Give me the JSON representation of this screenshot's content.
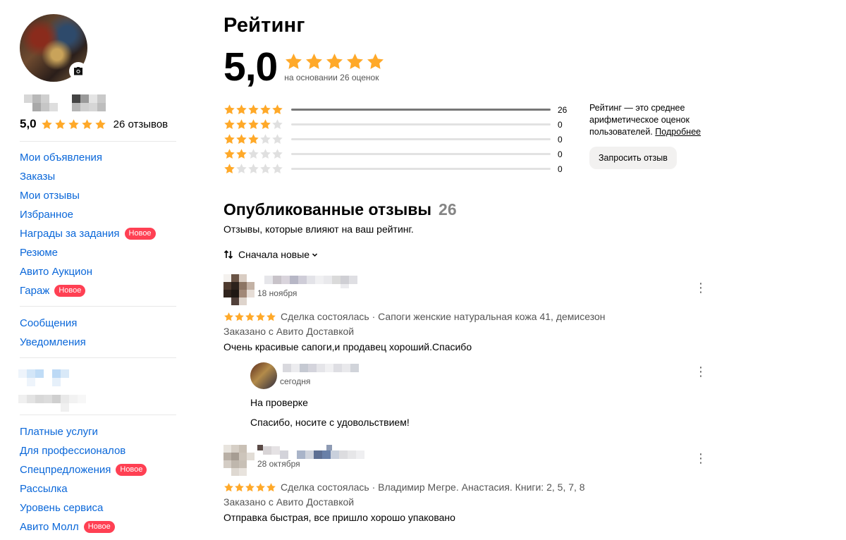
{
  "profile": {
    "rating": "5,0",
    "reviews_count_label": "26 отзывов"
  },
  "sidebar": {
    "group1": [
      {
        "label": "Мои объявления"
      },
      {
        "label": "Заказы"
      },
      {
        "label": "Мои отзывы"
      },
      {
        "label": "Избранное"
      },
      {
        "label": "Награды за задания",
        "badge": "Новое"
      },
      {
        "label": "Резюме"
      },
      {
        "label": "Авито Аукцион"
      },
      {
        "label": "Гараж",
        "badge": "Новое"
      }
    ],
    "group2": [
      {
        "label": "Сообщения"
      },
      {
        "label": "Уведомления"
      }
    ],
    "group4": [
      {
        "label": "Платные услуги"
      },
      {
        "label": "Для профессионалов"
      },
      {
        "label": "Спецпредложения",
        "badge": "Новое"
      },
      {
        "label": "Рассылка"
      },
      {
        "label": "Уровень сервиса"
      },
      {
        "label": "Авито Молл",
        "badge": "Новое"
      }
    ]
  },
  "rating_section": {
    "title": "Рейтинг",
    "value": "5,0",
    "based_on": "на основании 26 оценок",
    "distribution": [
      {
        "stars": 5,
        "count": 26,
        "fraction": 1.0
      },
      {
        "stars": 4,
        "count": 0,
        "fraction": 0
      },
      {
        "stars": 3,
        "count": 0,
        "fraction": 0
      },
      {
        "stars": 2,
        "count": 0,
        "fraction": 0
      },
      {
        "stars": 1,
        "count": 0,
        "fraction": 0
      }
    ],
    "info_text": "Рейтинг — это среднее арифметическое оценок пользователей. ",
    "info_link": "Подробнее",
    "request_button": "Запросить отзыв"
  },
  "published": {
    "title": "Опубликованные отзывы",
    "count": "26",
    "subtitle": "Отзывы, которые влияют на ваш рейтинг.",
    "sort_label": "Сначала новые"
  },
  "reviews": [
    {
      "date": "18 ноября",
      "stars": 5,
      "deal": "Сделка состоялась · Сапоги женские натуральная кожа 41, демисезон",
      "delivery": "Заказано с Авито Доставкой",
      "text": "Очень красивые сапоги,и продавец хороший.Спасибо",
      "reply": {
        "date": "сегодня",
        "status": "На проверке",
        "text": "Спасибо, носите с удовольствием!"
      }
    },
    {
      "date": "28 октября",
      "stars": 5,
      "deal": "Сделка состоялась · Владимир Мегре. Анастасия. Книги: 2, 5, 7, 8",
      "delivery": "Заказано с Авито Доставкой",
      "text": "Отправка быстрая, все пришло хорошо упаковано"
    }
  ],
  "colors": {
    "accent_link": "#0a67d9",
    "star": "#ffa929",
    "badge": "#ff4053"
  }
}
